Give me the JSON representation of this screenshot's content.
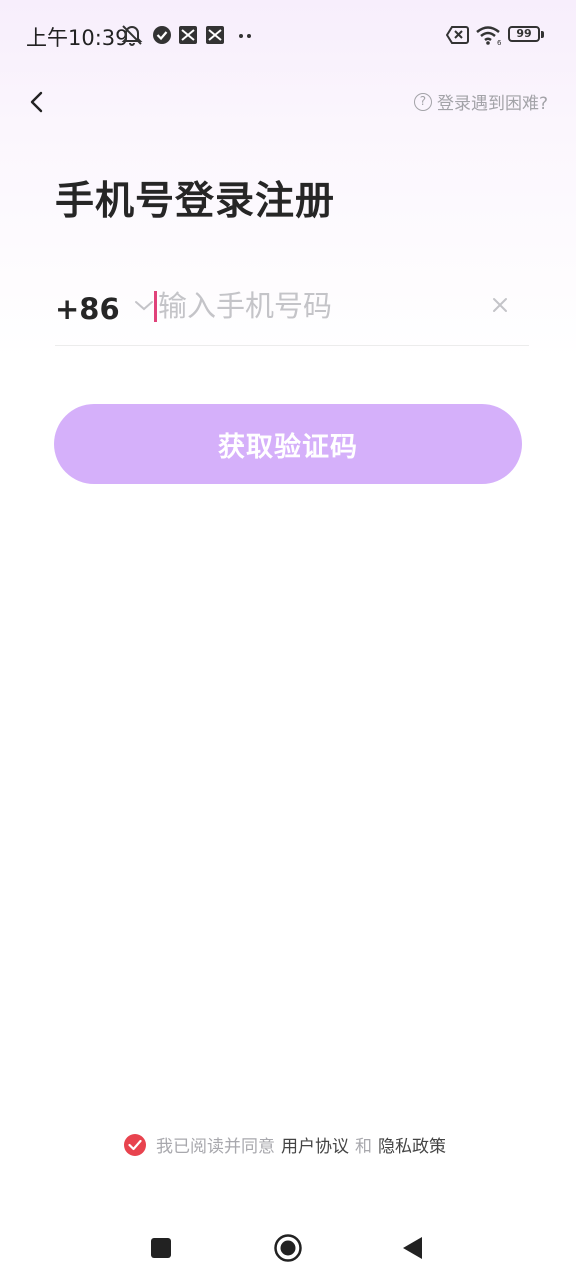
{
  "status_bar": {
    "time": "上午10:39",
    "battery": "99"
  },
  "header": {
    "help_text": "登录遇到困难?"
  },
  "page": {
    "title": "手机号登录注册"
  },
  "phone": {
    "country_code": "+86",
    "placeholder": "输入手机号码",
    "value": ""
  },
  "buttons": {
    "get_code": "获取验证码"
  },
  "agreement": {
    "prefix": "我已阅读并同意",
    "user_agreement": "用户协议",
    "and": "和",
    "privacy_policy": "隐私政策"
  },
  "colors": {
    "accent_button": "#d5b0fa",
    "cursor": "#e0427a",
    "check": "#e8434e"
  },
  "icons": {
    "status": [
      "bell-off-icon",
      "check-circle-icon",
      "app-icon",
      "app-icon",
      "more-dots-icon",
      "sim-off-icon",
      "wifi-icon",
      "battery-icon"
    ],
    "nav": [
      "recent-apps-icon",
      "home-icon",
      "back-icon"
    ]
  }
}
